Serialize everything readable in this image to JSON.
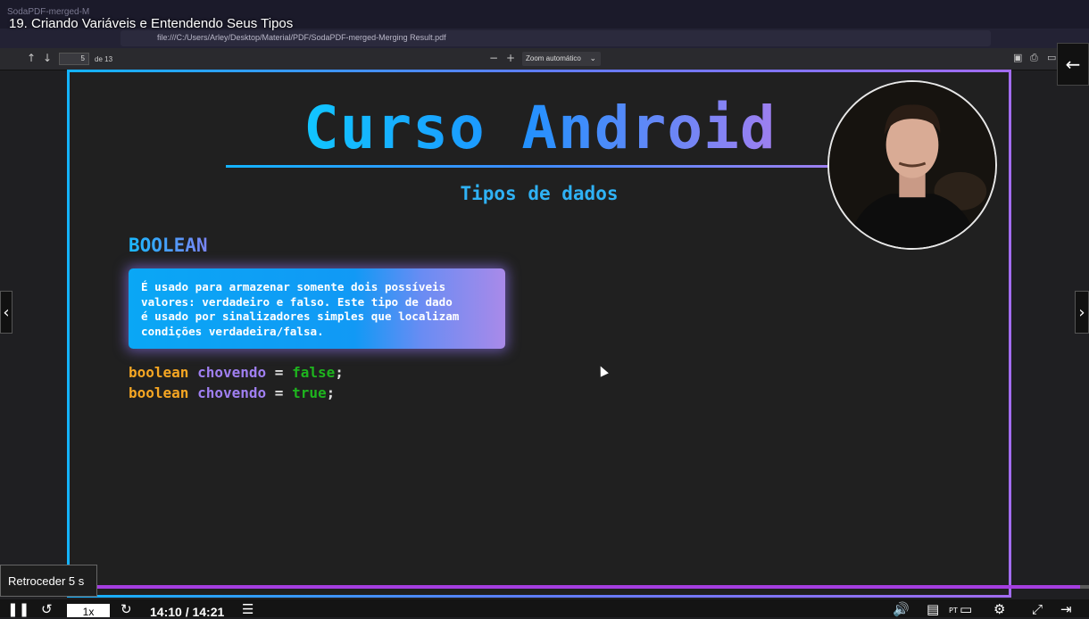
{
  "video": {
    "title": "19. Criando Variáveis e Entendendo Seus Tipos"
  },
  "browser": {
    "tab_ghost": "SodaPDF-merged-M",
    "url": "file:///C:/Users/Arley/Desktop/Material/PDF/SodaPDF-merged-Merging Result.pdf"
  },
  "pdf_toolbar": {
    "page_number": "5",
    "page_of": "de 13",
    "zoom_label": "Zoom automático"
  },
  "slide": {
    "title": "Curso Android",
    "subtitle": "Tipos de dados",
    "section": "BOOLEAN",
    "callout": "É usado para armazenar somente dois possíveis\nvalores: verdadeiro e falso. Este tipo de dado\né usado por sinalizadores simples que localizam\ncondições verdadeira/falsa.",
    "code_lines": [
      {
        "type": "boolean",
        "name": "chovendo",
        "op": "=",
        "value": "false",
        "end": ";"
      },
      {
        "type": "boolean",
        "name": "chovendo",
        "op": "=",
        "value": "true",
        "end": ";"
      }
    ]
  },
  "player": {
    "tooltip": "Retroceder 5 s",
    "speed": "1x",
    "time": "14:10 / 14:21",
    "progress_fraction": 0.9917,
    "subtitle_lang": "PT"
  },
  "icons": {
    "play_pause": "pause-icon",
    "rewind": "rewind-5-icon",
    "forward": "forward-5-icon",
    "playlist": "playlist-icon",
    "volume": "volume-icon",
    "subtitles": "subtitles-icon",
    "settings": "gear-icon",
    "fullscreen": "fullscreen-icon",
    "back": "arrow-left-icon"
  },
  "colors": {
    "accent_progress": "#a53ee0",
    "title_gradient_start": "#11c6ff",
    "title_gradient_end": "#9f7ff0",
    "keyword": "#f5a623",
    "variable": "#9f7ff0",
    "literal": "#1eb41e"
  }
}
